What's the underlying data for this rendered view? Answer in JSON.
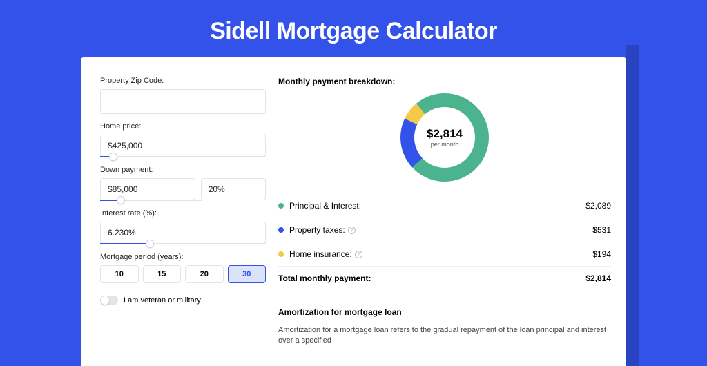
{
  "title": "Sidell Mortgage Calculator",
  "colors": {
    "principal": "#4cb38f",
    "taxes": "#3352e9",
    "insurance": "#f3c94a"
  },
  "form": {
    "zip_label": "Property Zip Code:",
    "zip_value": "",
    "price_label": "Home price:",
    "price_value": "$425,000",
    "price_fill_pct": 8,
    "dp_label": "Down payment:",
    "dp_amount": "$85,000",
    "dp_percent": "20%",
    "dp_fill_pct": 20,
    "rate_label": "Interest rate (%):",
    "rate_value": "6.230%",
    "rate_fill_pct": 30,
    "period_label": "Mortgage period (years):",
    "periods": [
      "10",
      "15",
      "20",
      "30"
    ],
    "period_active": "30",
    "veteran_label": "I am veteran or military"
  },
  "breakdown": {
    "heading": "Monthly payment breakdown:",
    "center_value": "$2,814",
    "center_sub": "per month",
    "items": [
      {
        "label": "Principal & Interest:",
        "value": "$2,089",
        "info": false
      },
      {
        "label": "Property taxes:",
        "value": "$531",
        "info": true
      },
      {
        "label": "Home insurance:",
        "value": "$194",
        "info": true
      }
    ],
    "total_label": "Total monthly payment:",
    "total_value": "$2,814"
  },
  "amortization": {
    "heading": "Amortization for mortgage loan",
    "text": "Amortization for a mortgage loan refers to the gradual repayment of the loan principal and interest over a specified"
  },
  "chart_data": {
    "type": "pie",
    "title": "Monthly payment breakdown",
    "series": [
      {
        "name": "Principal & Interest",
        "value": 2089
      },
      {
        "name": "Property taxes",
        "value": 531
      },
      {
        "name": "Home insurance",
        "value": 194
      }
    ],
    "total": 2814,
    "unit": "USD/month"
  }
}
